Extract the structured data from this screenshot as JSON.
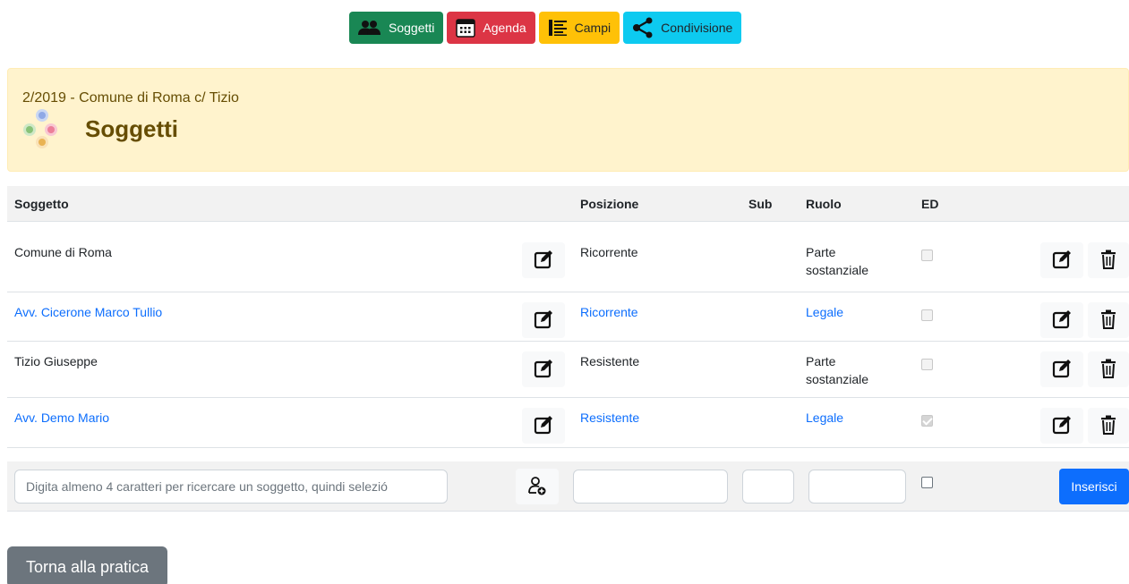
{
  "nav": {
    "soggetti": "Soggetti",
    "agenda": "Agenda",
    "campi": "Campi",
    "condivisione": "Condivisione"
  },
  "header": {
    "case_title": "2/2019 - Comune di Roma c/ Tizio",
    "page_title": "Soggetti"
  },
  "table": {
    "headers": {
      "soggetto": "Soggetto",
      "posizione": "Posizione",
      "sub": "Sub",
      "ruolo": "Ruolo",
      "ed": "ED"
    },
    "rows": [
      {
        "soggetto": "Comune di Roma",
        "posizione": "Ricorrente",
        "sub": "",
        "ruolo_line1": "Parte",
        "ruolo_line2": "sostanziale",
        "ed": false,
        "link": false
      },
      {
        "soggetto": "Avv. Cicerone Marco Tullio",
        "posizione": "Ricorrente",
        "sub": "",
        "ruolo_line1": "Legale",
        "ruolo_line2": "",
        "ed": false,
        "link": true
      },
      {
        "soggetto": "Tizio Giuseppe",
        "posizione": "Resistente",
        "sub": "",
        "ruolo_line1": "Parte",
        "ruolo_line2": "sostanziale",
        "ed": false,
        "link": false
      },
      {
        "soggetto": "Avv. Demo Mario",
        "posizione": "Resistente",
        "sub": "",
        "ruolo_line1": "Legale",
        "ruolo_line2": "",
        "ed": true,
        "link": true
      }
    ]
  },
  "insert": {
    "search_placeholder": "Digita almeno 4 caratteri per ricercare un soggetto, quindi selezió",
    "posizione_value": "",
    "sub_value": "",
    "ruolo_value": "",
    "insert_label": "Inserisci"
  },
  "back_label": "Torna alla pratica",
  "colors": {
    "green": "#198754",
    "red": "#dc3545",
    "yellow": "#ffc107",
    "cyan": "#0dcaf0",
    "link": "#0d6efd",
    "alert_bg": "#fff3cd"
  },
  "icons": {
    "nav_soggetti": "users-icon",
    "nav_agenda": "calendar-icon",
    "nav_campi": "list-icon",
    "nav_condivisione": "share-icon",
    "row_edit": "edit-icon",
    "row_delete": "trash-icon",
    "add_person": "person-add-icon"
  }
}
